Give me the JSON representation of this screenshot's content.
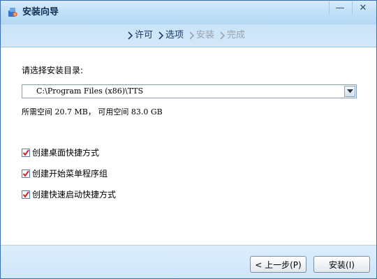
{
  "window": {
    "title": "安装向导",
    "minimize_symbol": "—",
    "close_symbol": "✕"
  },
  "steps": [
    {
      "label": "许可",
      "state": "active"
    },
    {
      "label": "选项",
      "state": "active"
    },
    {
      "label": "安装",
      "state": "inactive"
    },
    {
      "label": "完成",
      "state": "inactive"
    }
  ],
  "content": {
    "dir_label": "请选择安装目录:",
    "install_path": "C:\\Program Files (x86)\\TTS",
    "space_required_label": "所需空间",
    "space_required_value": "20.7 MB",
    "space_separator": "，",
    "space_available_label": "可用空间",
    "space_available_value": "83.0 GB",
    "options": [
      {
        "label": "创建桌面快捷方式",
        "checked": true
      },
      {
        "label": "创建开始菜单程序组",
        "checked": true
      },
      {
        "label": "创建快速启动快捷方式",
        "checked": true
      }
    ]
  },
  "footer": {
    "back_label": "< 上一步(P)",
    "install_label": "安装(I)"
  },
  "colors": {
    "check_mark": "#c8242b",
    "step_active": "#1a3b66",
    "step_inactive": "#9aa3ad"
  },
  "icons": {
    "app": "installer-icon",
    "step_arrow": "chevron-right-icon",
    "combo": "dropdown-arrow-icon",
    "checkbox": "checkbox-checked-icon"
  }
}
